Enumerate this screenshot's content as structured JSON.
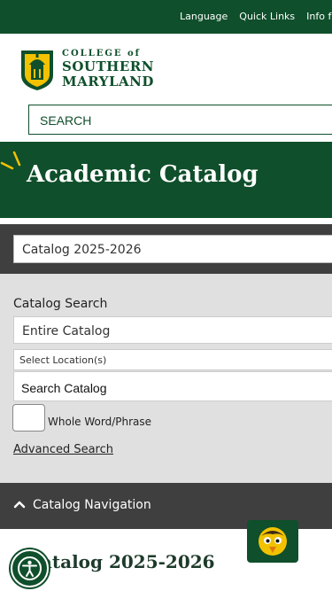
{
  "topbar": {
    "links": [
      "Language",
      "Quick Links",
      "Info f"
    ]
  },
  "brand": {
    "line1": "COLLEGE of",
    "line2": "SOUTHERN",
    "line3": "MARYLAND"
  },
  "site_search": {
    "placeholder": "SEARCH"
  },
  "hero": {
    "title": "Academic Catalog"
  },
  "catalog_select": {
    "value": "Catalog 2025-2026"
  },
  "catalog_search": {
    "label": "Catalog Search",
    "scope_value": "Entire Catalog",
    "location_value": "Select Location(s)",
    "query_placeholder": "Search Catalog",
    "whole_word_label": "Whole Word/Phrase",
    "advanced_link": "Advanced Search"
  },
  "catalog_nav": {
    "label": "Catalog Navigation"
  },
  "page": {
    "title": "Catalog 2025-2026"
  },
  "colors": {
    "brand_green": "#0f4f2b",
    "dark_gray": "#3f3f3f",
    "panel_gray": "#e0e0e0",
    "accent_gold": "#f2c200"
  }
}
